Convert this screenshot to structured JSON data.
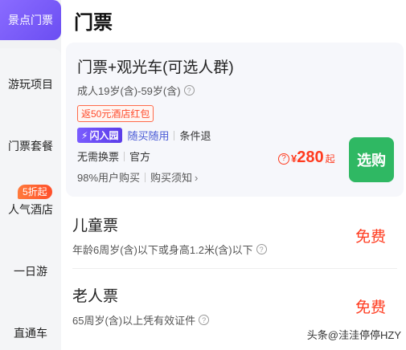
{
  "sidebar": {
    "active": "景点门票",
    "items": [
      "游玩项目",
      "门票套餐",
      "人气酒店",
      "一日游",
      "直通车"
    ],
    "badge": "5折起"
  },
  "main": {
    "title": "门票",
    "card": {
      "title": "门票+观光车(可选人群)",
      "subtitle": "成人19岁(含)-59岁(含)",
      "coupon": "返50元酒店红包",
      "flash_badge": "闪入园",
      "tag_blue": "随买随用",
      "tag_refund": "条件退",
      "tag_no_exchange": "无需换票",
      "tag_official": "官方",
      "rate": "98%用户购买",
      "notice": "购买须知",
      "price_yen": "¥",
      "price": "280",
      "price_suffix": "起",
      "buy_label": "选购"
    },
    "tickets": [
      {
        "title": "儿童票",
        "desc": "年龄6周岁(含)以下或身高1.2米(含)以下",
        "price": "免费"
      },
      {
        "title": "老人票",
        "desc": "65周岁(含)以上凭有效证件",
        "price": "免费"
      }
    ]
  },
  "watermark": "头条@洼洼停停HZY",
  "colors": {
    "accent": "#6b4ef2",
    "price": "#ff3b1f",
    "buy": "#2fb863"
  }
}
